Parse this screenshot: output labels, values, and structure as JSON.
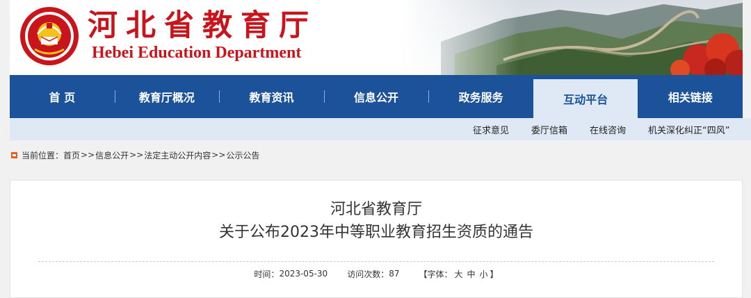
{
  "header": {
    "title_cn": "河北省教育厅",
    "title_en": "Hebei Education Department",
    "emblem_text": "Hebei Education Department"
  },
  "nav": {
    "items": [
      {
        "label": "首 页"
      },
      {
        "label": "教育厅概况"
      },
      {
        "label": "教育资讯"
      },
      {
        "label": "信息公开"
      },
      {
        "label": "政务服务"
      },
      {
        "label": "互动平台"
      },
      {
        "label": "相关链接"
      }
    ],
    "active_index": 5
  },
  "subnav": {
    "items": [
      "征求意见",
      "委厅信箱",
      "在线咨询",
      "机关深化纠正“四风”"
    ]
  },
  "breadcrumb": {
    "prefix": "当前位置：",
    "items": [
      "首页",
      "信息公开",
      "法定主动公开内容",
      "公示公告"
    ],
    "separator": ">>"
  },
  "article": {
    "title_line1": "河北省教育厅",
    "title_line2": "关于公布2023年中等职业教育招生资质的通告",
    "time_label": "时间：",
    "time_value": "2023-05-30",
    "visits_label": "访问次数：",
    "visits_value": "87",
    "font_label_open": "【字体：",
    "font_large": "大",
    "font_medium": "中",
    "font_small": "小",
    "font_label_close": "】"
  },
  "colors": {
    "brand_red": "#c9141b",
    "nav_blue": "#1b5299",
    "subnav_bg": "#dfe9f6",
    "breadcrumb_icon": "#e0601c"
  }
}
